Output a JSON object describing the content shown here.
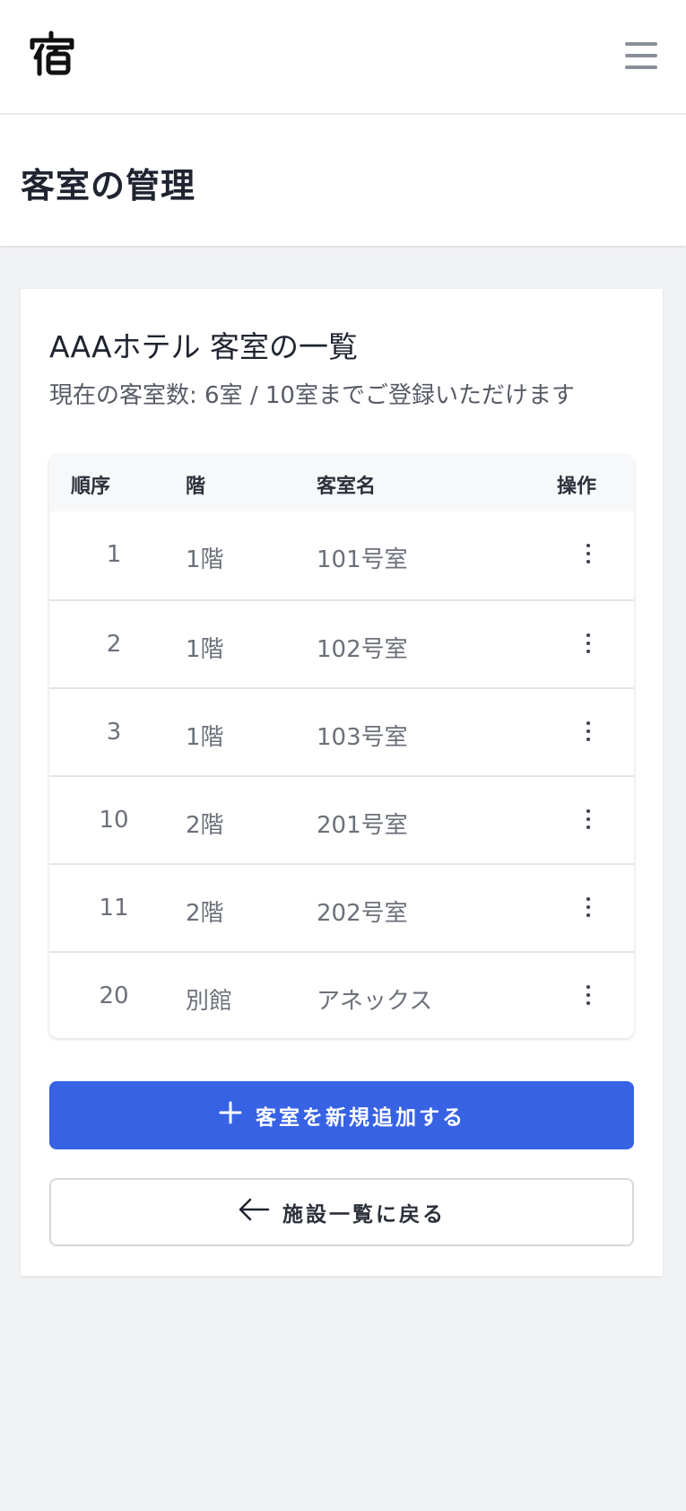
{
  "app": {
    "logo_text": "宿"
  },
  "header": {
    "title": "客室の管理"
  },
  "card": {
    "title": "AAAホテル 客室の一覧",
    "subtitle": "現在の客室数: 6室 / 10室までご登録いただけます"
  },
  "table": {
    "columns": [
      "順序",
      "階",
      "客室名",
      "操作"
    ],
    "rows": [
      {
        "order": "1",
        "floor": "1階",
        "name": "101号室"
      },
      {
        "order": "2",
        "floor": "1階",
        "name": "102号室"
      },
      {
        "order": "3",
        "floor": "1階",
        "name": "103号室"
      },
      {
        "order": "10",
        "floor": "2階",
        "name": "201号室"
      },
      {
        "order": "11",
        "floor": "2階",
        "name": "202号室"
      },
      {
        "order": "20",
        "floor": "別館",
        "name": "アネックス"
      }
    ]
  },
  "actions": {
    "add_label": "客室を新規追加する",
    "add_icon": "plus-icon",
    "back_label": "施設一覧に戻る",
    "back_icon": "arrow-left-icon"
  },
  "colors": {
    "primary": "#3762e4",
    "background": "#f1f2f4",
    "menu_icon": "#8a8f99"
  }
}
